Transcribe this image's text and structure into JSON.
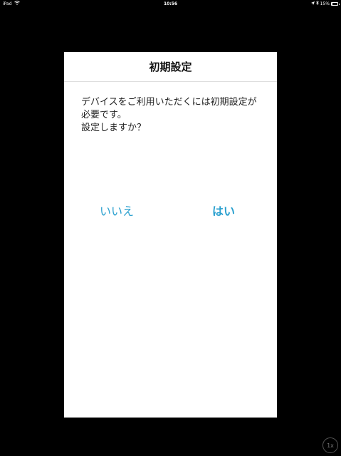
{
  "status_bar": {
    "device": "iPad",
    "time": "10:56",
    "battery": "15%",
    "battery_level": 0.15
  },
  "dialog": {
    "title": "初期設定",
    "message_lines": [
      "デバイスをご利用いただくには初期設定が",
      "必要です。",
      "設定しますか？"
    ],
    "no_label": "いいえ",
    "yes_label": "はい"
  },
  "zoom_label": "1x",
  "colors": {
    "accent": "#2aa0cf",
    "background": "#000000",
    "dialog_bg": "#ffffff"
  }
}
